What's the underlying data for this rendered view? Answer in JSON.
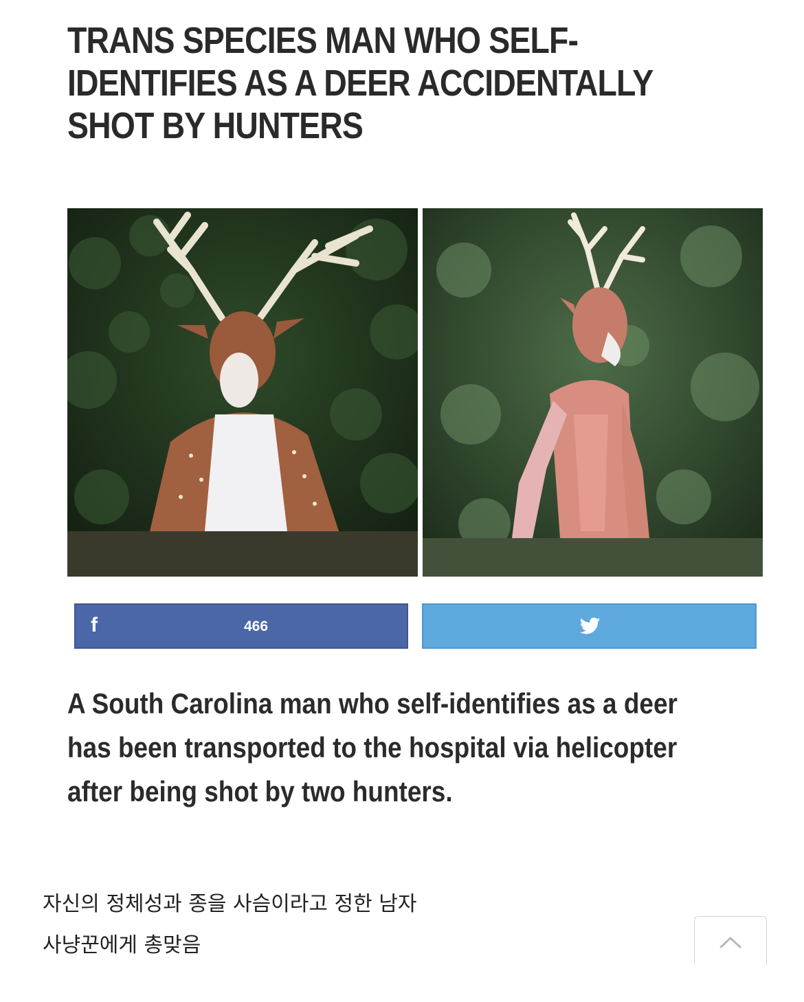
{
  "article": {
    "headline": "TRANS SPECIES MAN WHO SELF-IDENTIFIES AS A DEER ACCIDENTALLY SHOT BY HUNTERS",
    "lede": "A South Carolina man who self-identifies as a deer has been transported to the hospital via helicopter after being shot by two hunters."
  },
  "share": {
    "facebook_icon": "f",
    "facebook_count": "466",
    "twitter_icon": "twitter-bird-icon"
  },
  "caption": {
    "line1": "자신의 정체성과 종을 사슴이라고 정한 남자",
    "line2": "사냥꾼에게 총맞음"
  },
  "colors": {
    "facebook": "#4b67a8",
    "twitter": "#5ea9dd",
    "headline_text": "#2a2a2a"
  }
}
